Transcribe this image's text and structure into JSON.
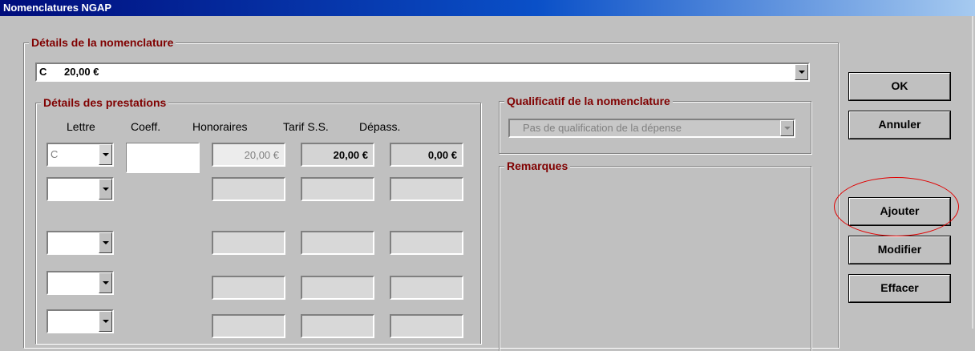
{
  "window": {
    "title": "Nomenclatures NGAP"
  },
  "details": {
    "legend": "Détails de la nomenclature",
    "combo_value": "C      20,00 €"
  },
  "prestations": {
    "legend": "Détails des prestations",
    "columns": [
      "Lettre",
      "Coeff.",
      "Honoraires",
      "Tarif S.S.",
      "Dépass."
    ],
    "rows": [
      {
        "lettre": "C",
        "coeff": "",
        "honoraires": "20,00 €",
        "tarif": "20,00 €",
        "depass": "0,00 €"
      },
      {
        "lettre": "",
        "coeff": "",
        "honoraires": "",
        "tarif": "",
        "depass": ""
      },
      {
        "lettre": "",
        "coeff": "",
        "honoraires": "",
        "tarif": "",
        "depass": ""
      },
      {
        "lettre": "",
        "coeff": "",
        "honoraires": "",
        "tarif": "",
        "depass": ""
      },
      {
        "lettre": "",
        "coeff": "",
        "honoraires": "",
        "tarif": "",
        "depass": ""
      }
    ]
  },
  "qualificatif": {
    "legend": "Qualificatif de la nomenclature",
    "value": "Pas de qualification de la dépense"
  },
  "remarques": {
    "legend": "Remarques"
  },
  "buttons": {
    "ok": "OK",
    "annuler": "Annuler",
    "ajouter": "Ajouter",
    "modifier": "Modifier",
    "effacer": "Effacer"
  },
  "colors": {
    "legend_text": "#800000",
    "highlight": "#e00000",
    "title_bar": "#000c7b"
  }
}
